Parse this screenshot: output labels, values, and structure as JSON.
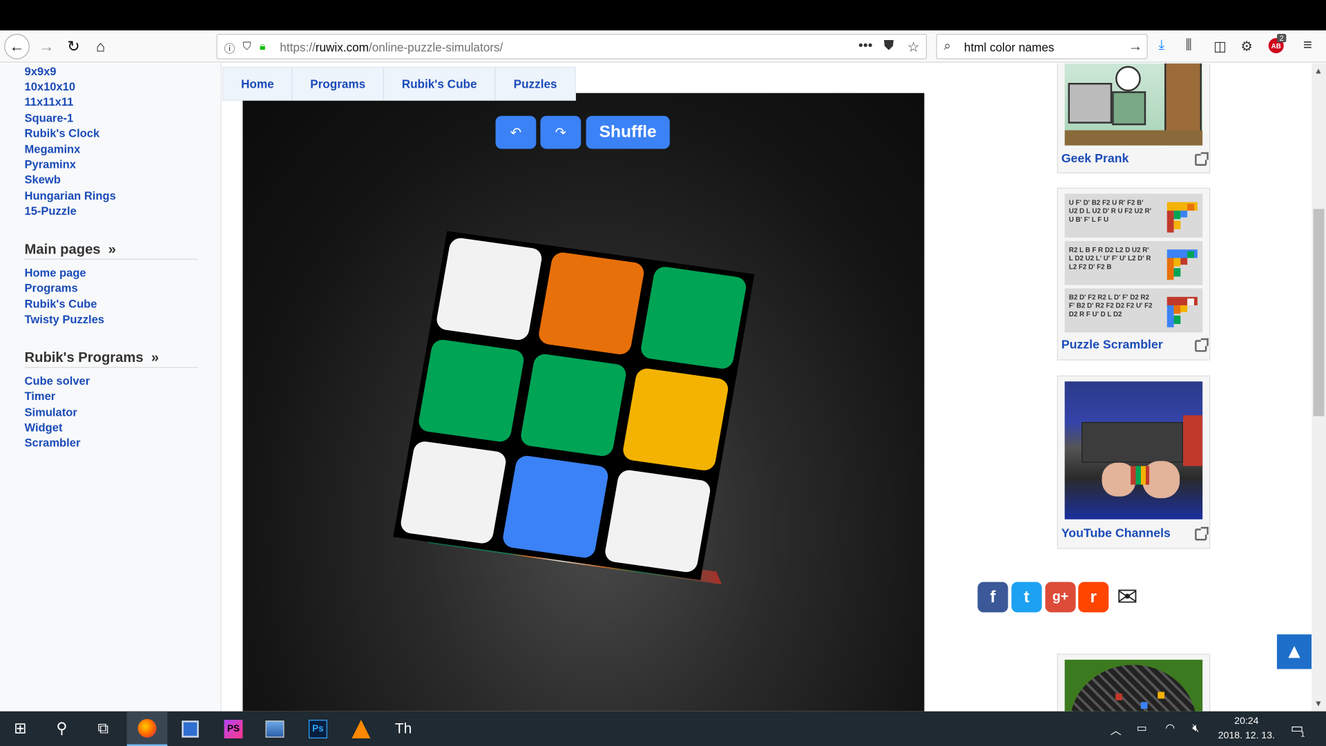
{
  "browser": {
    "url_prefix": "https://",
    "url_host": "ruwix.com",
    "url_path": "/online-puzzle-simulators/",
    "search_text": "html color names",
    "badge_count": "2",
    "icons": [
      "back-icon",
      "forward-icon",
      "reload-icon",
      "home-icon",
      "info-icon",
      "tracking-shield-icon",
      "lock-icon",
      "more-icon",
      "pocket-icon",
      "bookmark-star-icon",
      "search-icon",
      "go-arrow-icon",
      "download-icon",
      "library-icon",
      "sidebar-icon",
      "extension-icon",
      "adblock-icon",
      "menu-icon"
    ]
  },
  "sidebar": {
    "puzzle_links": [
      "9x9x9",
      "10x10x10",
      "11x11x11",
      "Square-1",
      "Rubik's Clock",
      "Megaminx",
      "Pyraminx",
      "Skewb",
      "Hungarian Rings",
      "15-Puzzle"
    ],
    "main_pages_title": "Main pages",
    "main_pages_arrow": "»",
    "main_pages": [
      "Home page",
      "Programs",
      "Rubik's Cube",
      "Twisty Puzzles"
    ],
    "programs_title": "Rubik's Programs",
    "programs_arrow": "»",
    "programs": [
      "Cube solver",
      "Timer",
      "Simulator",
      "Widget",
      "Scrambler"
    ]
  },
  "tabs": [
    "Home",
    "Programs",
    "Rubik's Cube",
    "Puzzles"
  ],
  "simulator": {
    "undo_icon": "undo-icon",
    "redo_icon": "redo-icon",
    "undo_glyph": "↶",
    "redo_glyph": "↷",
    "shuffle_label": "Shuffle",
    "front_face": [
      [
        "white",
        "orange",
        "green"
      ],
      [
        "green",
        "green",
        "yellow"
      ],
      [
        "white",
        "blue",
        "white"
      ]
    ],
    "colors": {
      "white": "#f2f2f2",
      "orange": "#e8700a",
      "green": "#00a455",
      "yellow": "#f3b300",
      "blue": "#3b82f6",
      "red": "#c0392b"
    }
  },
  "right_column": {
    "cards": [
      {
        "title": "Geek Prank"
      },
      {
        "title": "Puzzle Scrambler"
      },
      {
        "title": "YouTube Channels"
      }
    ],
    "scrambles": [
      "U F' D' B2 F2 U R' F2 B' U2 D L U2 D' R U F2 U2 R' U B' F' L F U",
      "R2 L B F R D2 L2 D U2 R' L D2 U2 L' U' F' U' L2 D' R L2 F2 D' F2 B",
      "B2 D' F2 R2 L D' F' D2 R2 F' B2 D' R2 F2 D2 F2 U' F2 D2 R F U' D L D2"
    ],
    "social": [
      {
        "name": "facebook",
        "glyph": "f",
        "color": "#3b5998"
      },
      {
        "name": "twitter",
        "glyph": "t",
        "color": "#1da1f2"
      },
      {
        "name": "google-plus",
        "glyph": "g+",
        "color": "#dd4b39"
      },
      {
        "name": "reddit",
        "glyph": "r",
        "color": "#ff4500"
      },
      {
        "name": "email",
        "glyph": "✉",
        "color": "#222222"
      }
    ]
  },
  "taskbar": {
    "apps": [
      "start-icon",
      "search-icon",
      "task-view-icon",
      "firefox-icon",
      "save-icon",
      "phpstorm-icon",
      "paint-icon",
      "photoshop-icon",
      "vlc-icon",
      "typora-icon"
    ],
    "time": "20:24",
    "date": "2018. 12. 13.",
    "notification_count": "1"
  }
}
